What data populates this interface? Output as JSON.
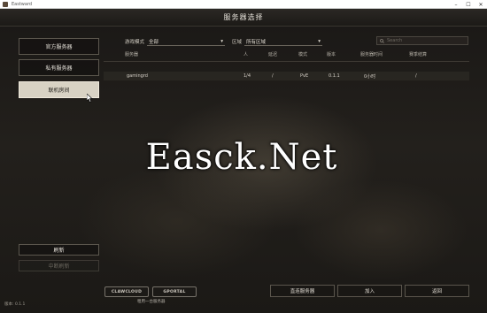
{
  "window": {
    "title": "Eastward"
  },
  "header": {
    "title": "服务器选择"
  },
  "sidebar": {
    "items": [
      {
        "label": "官方服务器",
        "active": false
      },
      {
        "label": "私有服务器",
        "active": false
      },
      {
        "label": "联机房间",
        "active": true
      }
    ],
    "refresh_label": "刷新",
    "disabled_label": "中断刷新"
  },
  "filters": {
    "mode_label": "游戏模式",
    "mode_value": "全部",
    "region_label": "区域",
    "region_value": "所有区域",
    "search_placeholder": "Search"
  },
  "table": {
    "columns": [
      "服务器",
      "人",
      "延迟",
      "模式",
      "版本",
      "服务器时间",
      "赛季结算"
    ],
    "rows": [
      {
        "name": "gamingrd",
        "players": "1/4",
        "ping": "/",
        "mode": "PvE",
        "version": "0.1.1",
        "time": "0小时",
        "season": "/"
      }
    ]
  },
  "footer": {
    "logo1": "CLAWCLOUD",
    "logo2": "GPORTAL",
    "logo_caption": "租用一台服务器",
    "buttons": [
      "直连服务器",
      "加入",
      "返回"
    ],
    "version": "版本: 0.1.1"
  },
  "watermark": "Easck.Net",
  "colors": {
    "accent": "#d8d2c4",
    "background": "#141210"
  }
}
